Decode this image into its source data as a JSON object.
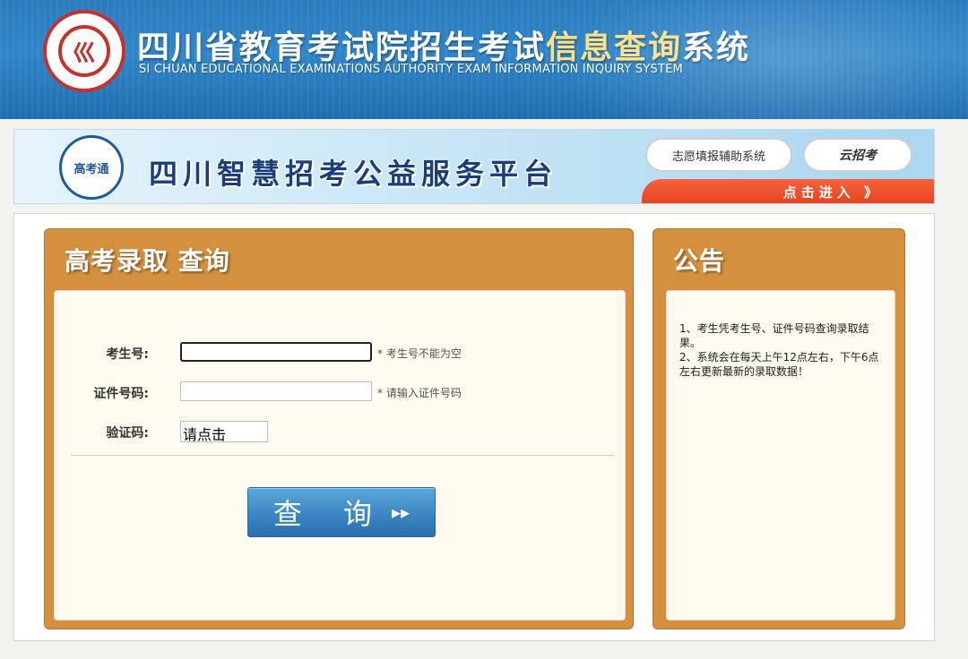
{
  "header": {
    "seal_char": "巛",
    "title_part1": "四川省教育考试院招生考试",
    "title_highlight": "信息查询",
    "title_part2": "系统",
    "subtitle_en": "SI CHUAN EDUCATIONAL EXAMINATIONS AUTHORITY EXAM INFORMATION INQUIRY SYSTEM"
  },
  "banner": {
    "logo_text": "高考通",
    "title": "四川智慧招考公益服务平台",
    "btn_volunteer": "志愿填报辅助系统",
    "btn_yunzhaokao": "云招考",
    "enter_label": "点击进入 》"
  },
  "query_panel": {
    "title": "高考录取  查询",
    "fields": {
      "exam_no_label": "考生号:",
      "exam_no_value": "",
      "exam_no_hint": "* 考生号不能为空",
      "id_label": "证件号码:",
      "id_value": "",
      "id_hint": "* 请输入证件号码",
      "captcha_label": "验证码:",
      "captcha_text": "请点击"
    },
    "submit_label": "查 询",
    "submit_arrow": "▸▸"
  },
  "notice_panel": {
    "title": "公告",
    "lines": [
      "1、考生凭考生号、证件号码查询录取结果。",
      "2、系统会在每天上午12点左右，下午6点左右更新最新的录取数据！"
    ]
  },
  "colors": {
    "header_blue": "#2f86c8",
    "panel_orange": "#d4903f",
    "enter_red": "#e8401d",
    "button_blue": "#3b86c4"
  }
}
